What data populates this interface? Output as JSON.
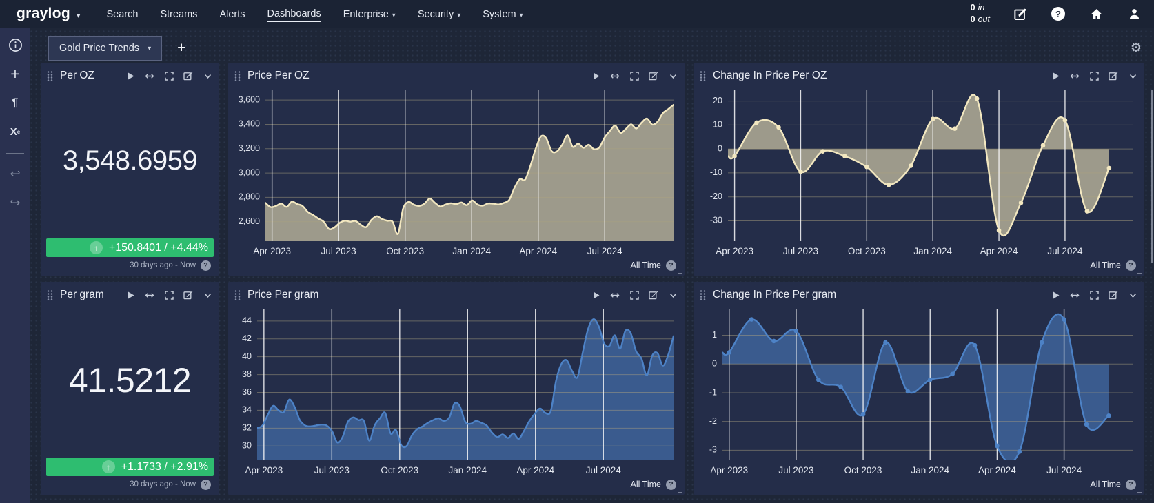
{
  "navbar": {
    "logo": "graylog",
    "items": [
      {
        "label": "Search",
        "active": false,
        "caret": false
      },
      {
        "label": "Streams",
        "active": false,
        "caret": false
      },
      {
        "label": "Alerts",
        "active": false,
        "caret": false
      },
      {
        "label": "Dashboards",
        "active": true,
        "caret": false
      },
      {
        "label": "Enterprise",
        "active": false,
        "caret": true
      },
      {
        "label": "Security",
        "active": false,
        "caret": true
      },
      {
        "label": "System",
        "active": false,
        "caret": true
      }
    ],
    "throughput": {
      "in_value": "0",
      "in_unit": "in",
      "out_value": "0",
      "out_unit": "out"
    },
    "action_icons": [
      "edit",
      "help",
      "home",
      "user"
    ]
  },
  "sidebar": {
    "icons": [
      "info",
      "add",
      "paragraph",
      "subscript-x",
      "undo",
      "redo"
    ]
  },
  "tabs": {
    "active_tab": "Gold Price Trends",
    "add_label": "+",
    "gear_icon": "settings"
  },
  "widget_action_icons": [
    "play",
    "move-horizontal",
    "fullscreen",
    "edit",
    "collapse"
  ],
  "widgets": {
    "per_oz": {
      "title": "Per OZ",
      "value": "3,548.6959",
      "trend": "+150.8401 / +4.44%",
      "timerange": "30 days ago - Now"
    },
    "price_per_oz": {
      "title": "Price Per OZ",
      "timerange": "All Time"
    },
    "change_per_oz": {
      "title": "Change In Price Per OZ",
      "timerange": "All Time"
    },
    "per_gram": {
      "title": "Per gram",
      "value": "41.5212",
      "trend": "+1.1733 / +2.91%",
      "timerange": "30 days ago - Now"
    },
    "price_per_gram": {
      "title": "Price Per gram",
      "timerange": "All Time"
    },
    "change_per_gram": {
      "title": "Change In Price Per gram",
      "timerange": "All Time"
    }
  },
  "colors": {
    "trend_up_green": "#2ebd70",
    "gold_line": "#f2e7c0",
    "gold_fill": "rgba(238,226,183,0.6)",
    "blue_line": "#4d82c6",
    "blue_fill": "rgba(77,130,198,0.55)",
    "vgrid": "rgba(250,250,250,0.85)",
    "hgrid": "rgba(173,164,128,0.48)"
  },
  "chart_data": [
    {
      "id": "price_per_oz",
      "type": "area",
      "title": "Price Per OZ",
      "interval": "weekly",
      "x_labels": [
        "Apr 2023",
        "Jul 2023",
        "Oct 2023",
        "Jan 2024",
        "Apr 2024",
        "Jul 2024"
      ],
      "gridline_months": [
        0,
        3,
        6,
        9,
        12,
        15
      ],
      "domain_months": [
        -0.3,
        18.1
      ],
      "x_mode": "spread",
      "ylim": [
        2440,
        3680
      ],
      "ytick_values": [
        2600,
        2800,
        3000,
        3200,
        3400,
        3600
      ],
      "ytick_labels": [
        "2,600",
        "2,800",
        "3,000",
        "3,200",
        "3,400",
        "3,600"
      ],
      "fill_to": "bottom",
      "markers": false,
      "line_color": "#f2e7c0",
      "fill_color": "rgba(238,226,183,0.6)",
      "values": [
        2755,
        2720,
        2730,
        2750,
        2722,
        2765,
        2745,
        2730,
        2680,
        2655,
        2625,
        2600,
        2540,
        2552,
        2590,
        2608,
        2600,
        2606,
        2575,
        2556,
        2615,
        2645,
        2622,
        2608,
        2600,
        2500,
        2710,
        2762,
        2740,
        2730,
        2748,
        2790,
        2755,
        2725,
        2742,
        2752,
        2744,
        2758,
        2736,
        2775,
        2742,
        2732,
        2750,
        2748,
        2742,
        2755,
        2780,
        2880,
        2950,
        2946,
        3060,
        3200,
        3302,
        3285,
        3180,
        3178,
        3232,
        3310,
        3215,
        3242,
        3208,
        3232,
        3196,
        3210,
        3292,
        3345,
        3390,
        3330,
        3362,
        3400,
        3366,
        3415,
        3448,
        3398,
        3422,
        3492,
        3525,
        3560
      ]
    },
    {
      "id": "change_in_price_per_oz",
      "type": "line",
      "title": "Change In Price Per OZ",
      "interval": "monthly",
      "x_start_month": "Apr 2023",
      "x_labels": [
        "Apr 2023",
        "Jul 2023",
        "Oct 2023",
        "Jan 2024",
        "Apr 2024",
        "Jul 2024"
      ],
      "gridline_months": [
        0,
        3,
        6,
        9,
        12,
        15
      ],
      "domain_months": [
        -0.3,
        18.1
      ],
      "x_mode": "months",
      "ylim": [
        -38.5,
        24.5
      ],
      "ytick_values": [
        20,
        10,
        0,
        -10,
        -20,
        -30
      ],
      "ytick_labels": [
        "20",
        "10",
        "0",
        "-10",
        "-20",
        "-30"
      ],
      "fill_to": "zero",
      "markers": true,
      "line_color": "#f2e7c0",
      "fill_color": "rgba(238,226,183,0.6)",
      "values": [
        -3,
        11,
        9,
        -9.5,
        -1,
        -3,
        -7.5,
        -15,
        -7,
        12.5,
        8.5,
        21,
        -34,
        -22.5,
        1.5,
        12,
        -26,
        -8
      ]
    },
    {
      "id": "price_per_gram",
      "type": "area",
      "title": "Price Per gram",
      "interval": "weekly",
      "x_labels": [
        "Apr 2023",
        "Jul 2023",
        "Oct 2023",
        "Jan 2024",
        "Apr 2024",
        "Jul 2024"
      ],
      "gridline_months": [
        0,
        3,
        6,
        9,
        12,
        15
      ],
      "domain_months": [
        -0.3,
        18.1
      ],
      "x_mode": "spread",
      "ylim": [
        28.4,
        45.3
      ],
      "ytick_values": [
        30,
        32,
        34,
        36,
        38,
        40,
        42,
        44
      ],
      "ytick_labels": [
        "30",
        "32",
        "34",
        "36",
        "38",
        "40",
        "42",
        "44"
      ],
      "fill_to": "bottom",
      "markers": false,
      "line_color": "#4d82c6",
      "fill_color": "rgba(77,130,198,0.55)",
      "values": [
        32.0,
        32.3,
        33.5,
        34.5,
        34.0,
        33.8,
        35.2,
        34.4,
        32.9,
        32.3,
        32.2,
        32.3,
        32.4,
        32.3,
        31.7,
        30.4,
        31.0,
        32.7,
        33.2,
        32.9,
        32.8,
        30.6,
        32.3,
        33.1,
        33.7,
        31.4,
        31.8,
        30.1,
        30.0,
        31.2,
        31.9,
        32.2,
        32.6,
        32.9,
        33.1,
        32.8,
        33.2,
        34.8,
        34.4,
        32.7,
        32.5,
        32.8,
        32.6,
        32.3,
        31.5,
        31.0,
        31.3,
        30.9,
        31.4,
        30.8,
        31.7,
        32.8,
        33.6,
        34.2,
        33.7,
        33.9,
        37.3,
        39.2,
        39.6,
        38.4,
        37.7,
        40.5,
        43.1,
        44.2,
        43.4,
        41.5,
        41.2,
        42.4,
        40.9,
        42.9,
        42.6,
        40.6,
        39.8,
        37.9,
        40.1,
        40.4,
        39.0,
        40.2,
        42.3
      ]
    },
    {
      "id": "change_in_price_per_gram",
      "type": "line",
      "title": "Change In Price Per gram",
      "interval": "monthly",
      "x_start_month": "Apr 2023",
      "x_labels": [
        "Apr 2023",
        "Jul 2023",
        "Oct 2023",
        "Jan 2024",
        "Apr 2024",
        "Jul 2024"
      ],
      "gridline_months": [
        0,
        3,
        6,
        9,
        12,
        15
      ],
      "domain_months": [
        -0.3,
        18.1
      ],
      "x_mode": "months",
      "ylim": [
        -3.35,
        1.9
      ],
      "ytick_values": [
        1,
        0,
        -1,
        -2,
        -3
      ],
      "ytick_labels": [
        "1",
        "0",
        "-1",
        "-2",
        "-3"
      ],
      "fill_to": "zero",
      "markers": true,
      "line_color": "#4d82c6",
      "fill_color": "rgba(77,130,198,0.55)",
      "values": [
        0.4,
        1.55,
        0.8,
        1.15,
        -0.55,
        -0.8,
        -1.75,
        0.75,
        -0.95,
        -0.55,
        -0.35,
        0.65,
        -2.85,
        -3.05,
        0.75,
        1.55,
        -2.1,
        -1.8
      ]
    }
  ]
}
